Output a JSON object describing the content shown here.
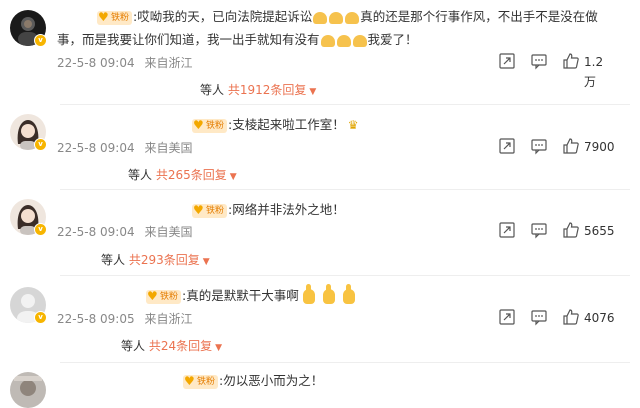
{
  "fan_badge_label": "铁粉",
  "comments": [
    {
      "avatar": "dark-portrait",
      "text_line1": "哎呦我的天，已向法院提起诉讼",
      "text_line1_tail": "真的还是那个行事作风，不出手不是没在做",
      "text_line2": "事，而是我要让你们知道，我一出手就知有没有",
      "text_line2_tail": "我爱了！",
      "timestamp": "22-5-8 09:04",
      "location": "来自浙江",
      "like_count": "1.2万",
      "replies_prefix": "等人",
      "replies_count": "共1912条回复"
    },
    {
      "avatar": "girl-portrait",
      "text": "支棱起来啦工作室！",
      "timestamp": "22-5-8 09:04",
      "location": "来自美国",
      "like_count": "7900",
      "replies_prefix": "等人",
      "replies_count": "共265条回复"
    },
    {
      "avatar": "girl-portrait",
      "text": "网络并非法外之地！",
      "timestamp": "22-5-8 09:04",
      "location": "来自美国",
      "like_count": "5655",
      "replies_prefix": "等人",
      "replies_count": "共293条回复"
    },
    {
      "avatar": "default-gray",
      "text": "真的是默默干大事啊",
      "timestamp": "22-5-8 09:05",
      "location": "来自浙江",
      "like_count": "4076",
      "replies_prefix": "等人",
      "replies_count": "共24条回复"
    },
    {
      "avatar": "gray-portrait",
      "text": "勿以恶小而为之！"
    }
  ],
  "icons": {
    "share": "share-icon",
    "comment": "comment-icon",
    "like": "thumbs-up-icon",
    "expand": "caret-down-icon"
  },
  "colors": {
    "reply_count": "#eb7350",
    "meta_text": "#888888",
    "fan_badge_bg": "#ffe9c6",
    "fan_badge_text": "#e47d00"
  }
}
